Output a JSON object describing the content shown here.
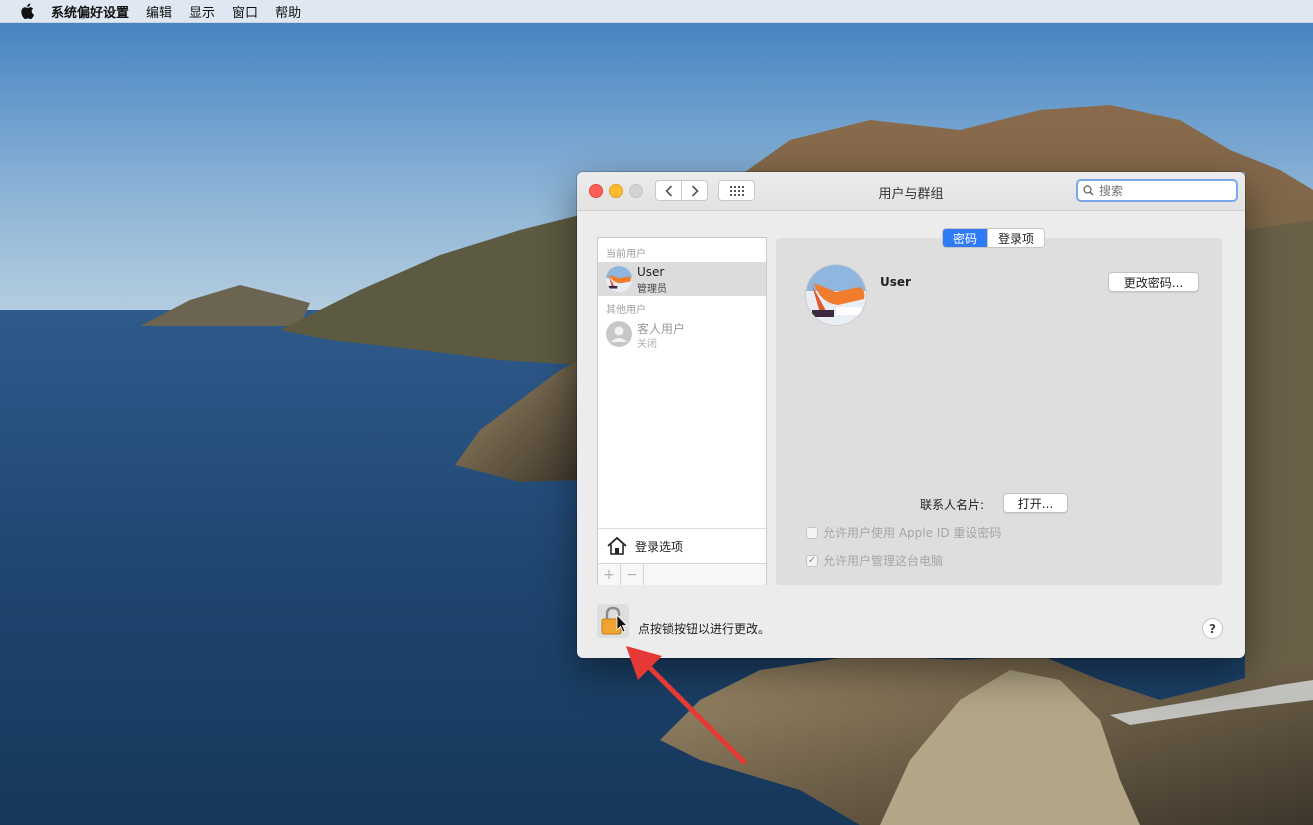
{
  "menubar": {
    "app_name": "系统偏好设置",
    "items": [
      "编辑",
      "显示",
      "窗口",
      "帮助"
    ]
  },
  "window": {
    "title": "用户与群组",
    "search_placeholder": "搜索"
  },
  "sidebar": {
    "current_users_header": "当前用户",
    "current_user": {
      "name": "User",
      "role": "管理员"
    },
    "other_users_header": "其他用户",
    "guest_user": {
      "name": "客人用户",
      "status": "关闭"
    },
    "login_options_label": "登录选项",
    "add_label": "+",
    "remove_label": "−"
  },
  "tabs": {
    "password": "密码",
    "login_items": "登录项"
  },
  "user_detail": {
    "name": "User",
    "change_password_button": "更改密码...",
    "contact_card_label": "联系人名片:",
    "open_button": "打开...",
    "allow_apple_id_reset": "允许用户使用 Apple ID 重设密码",
    "allow_admin": "允许用户管理这台电脑",
    "allow_apple_id_reset_checked": false,
    "allow_admin_checked": true
  },
  "footer": {
    "lock_text": "点按锁按钮以进行更改。",
    "help_label": "?"
  },
  "icons": [
    "apple-logo-icon",
    "back-chevron-icon",
    "forward-chevron-icon",
    "grid-icon",
    "search-icon",
    "house-icon",
    "lock-icon",
    "cursor-icon",
    "annotation-arrow-icon"
  ],
  "colors": {
    "accent": "#2f7bf6",
    "annotation": "#e53935"
  }
}
